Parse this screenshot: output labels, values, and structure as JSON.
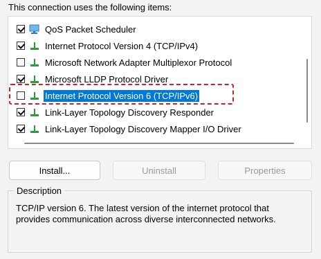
{
  "items_label": "This connection uses the following items:",
  "items": [
    {
      "label": "QoS Packet Scheduler",
      "checked": true,
      "icon": "qos-scheduler-icon",
      "selected": false
    },
    {
      "label": "Internet Protocol Version 4 (TCP/IPv4)",
      "checked": true,
      "icon": "network-protocol-icon",
      "selected": false
    },
    {
      "label": "Microsoft Network Adapter Multiplexor Protocol",
      "checked": false,
      "icon": "network-protocol-icon",
      "selected": false
    },
    {
      "label": "Microsoft LLDP Protocol Driver",
      "checked": true,
      "icon": "network-protocol-icon",
      "selected": false
    },
    {
      "label": "Internet Protocol Version 6 (TCP/IPv6)",
      "checked": false,
      "icon": "network-protocol-icon",
      "selected": true
    },
    {
      "label": "Link-Layer Topology Discovery Responder",
      "checked": true,
      "icon": "network-protocol-icon",
      "selected": false
    },
    {
      "label": "Link-Layer Topology Discovery Mapper I/O Driver",
      "checked": true,
      "icon": "network-protocol-icon",
      "selected": false
    }
  ],
  "buttons": {
    "install": "Install...",
    "uninstall": "Uninstall",
    "properties": "Properties"
  },
  "description": {
    "title": "Description",
    "text": "TCP/IP version 6. The latest version of the internet protocol that provides communication across diverse interconnected networks."
  },
  "colors": {
    "selection": "#0078d7",
    "focus_highlight": "#d02020",
    "protocol_icon_green": "#2e9b3a"
  }
}
